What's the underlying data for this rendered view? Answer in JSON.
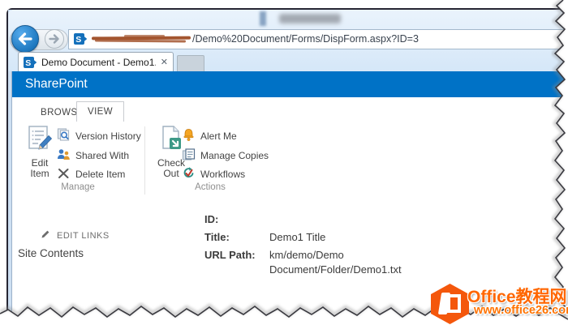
{
  "browser": {
    "tab": {
      "title": "Demo Document - Demo1...."
    },
    "address": {
      "url_tail": "/Demo%20Document/Forms/DispForm.aspx?ID=3"
    }
  },
  "icons": {
    "close_tab": "✕",
    "back": "back-arrow",
    "forward": "forward-arrow",
    "favicon": "sharepoint-logo"
  },
  "suite": {
    "brand": "SharePoint"
  },
  "ribbon": {
    "tabs": [
      {
        "label": "BROWSE"
      },
      {
        "label": "VIEW",
        "active": true
      }
    ],
    "groups": [
      {
        "label": "Manage",
        "large": {
          "name": "edit-item",
          "lines": [
            "Edit",
            "Item"
          ]
        },
        "small": [
          {
            "label": "Version History"
          },
          {
            "label": "Shared With"
          },
          {
            "label": "Delete Item"
          }
        ]
      },
      {
        "label": "Actions",
        "large": {
          "name": "check-out",
          "lines": [
            "Check",
            "Out"
          ]
        },
        "small": [
          {
            "label": "Alert Me"
          },
          {
            "label": "Manage Copies"
          },
          {
            "label": "Workflows"
          }
        ]
      }
    ]
  },
  "nav": {
    "edit_links": "EDIT LINKS",
    "site_contents": "Site Contents"
  },
  "form": {
    "rows": [
      {
        "label": "ID:",
        "value": ""
      },
      {
        "label": "Title:",
        "value": "Demo1 Title"
      },
      {
        "label": "URL Path:",
        "value": "km/demo/Demo Document/Folder/Demo1.txt"
      }
    ]
  },
  "watermark": {
    "title": "Office教程网",
    "site": "www.office26.com"
  },
  "colors": {
    "suite_blue": "#0072c6",
    "accent_orange": "#f4570c",
    "redaction_brown": "#a3552f"
  }
}
